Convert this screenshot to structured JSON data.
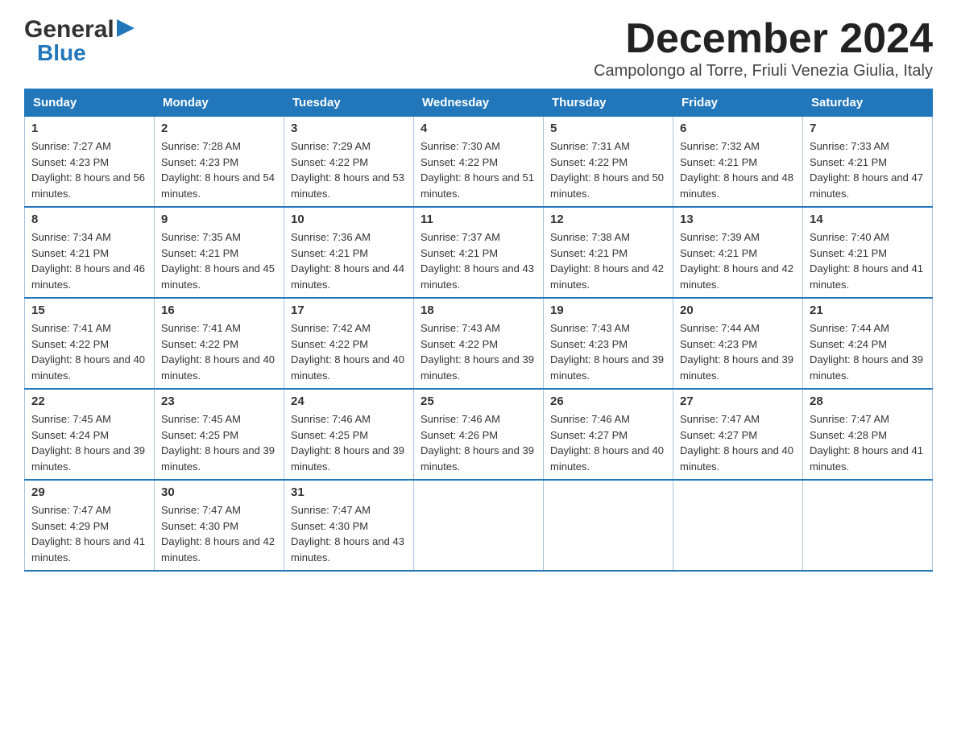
{
  "header": {
    "logo_general": "General",
    "logo_blue": "Blue",
    "title": "December 2024",
    "subtitle": "Campolongo al Torre, Friuli Venezia Giulia, Italy"
  },
  "calendar": {
    "days_of_week": [
      "Sunday",
      "Monday",
      "Tuesday",
      "Wednesday",
      "Thursday",
      "Friday",
      "Saturday"
    ],
    "weeks": [
      [
        {
          "day": "1",
          "sunrise": "7:27 AM",
          "sunset": "4:23 PM",
          "daylight": "8 hours and 56 minutes."
        },
        {
          "day": "2",
          "sunrise": "7:28 AM",
          "sunset": "4:23 PM",
          "daylight": "8 hours and 54 minutes."
        },
        {
          "day": "3",
          "sunrise": "7:29 AM",
          "sunset": "4:22 PM",
          "daylight": "8 hours and 53 minutes."
        },
        {
          "day": "4",
          "sunrise": "7:30 AM",
          "sunset": "4:22 PM",
          "daylight": "8 hours and 51 minutes."
        },
        {
          "day": "5",
          "sunrise": "7:31 AM",
          "sunset": "4:22 PM",
          "daylight": "8 hours and 50 minutes."
        },
        {
          "day": "6",
          "sunrise": "7:32 AM",
          "sunset": "4:21 PM",
          "daylight": "8 hours and 48 minutes."
        },
        {
          "day": "7",
          "sunrise": "7:33 AM",
          "sunset": "4:21 PM",
          "daylight": "8 hours and 47 minutes."
        }
      ],
      [
        {
          "day": "8",
          "sunrise": "7:34 AM",
          "sunset": "4:21 PM",
          "daylight": "8 hours and 46 minutes."
        },
        {
          "day": "9",
          "sunrise": "7:35 AM",
          "sunset": "4:21 PM",
          "daylight": "8 hours and 45 minutes."
        },
        {
          "day": "10",
          "sunrise": "7:36 AM",
          "sunset": "4:21 PM",
          "daylight": "8 hours and 44 minutes."
        },
        {
          "day": "11",
          "sunrise": "7:37 AM",
          "sunset": "4:21 PM",
          "daylight": "8 hours and 43 minutes."
        },
        {
          "day": "12",
          "sunrise": "7:38 AM",
          "sunset": "4:21 PM",
          "daylight": "8 hours and 42 minutes."
        },
        {
          "day": "13",
          "sunrise": "7:39 AM",
          "sunset": "4:21 PM",
          "daylight": "8 hours and 42 minutes."
        },
        {
          "day": "14",
          "sunrise": "7:40 AM",
          "sunset": "4:21 PM",
          "daylight": "8 hours and 41 minutes."
        }
      ],
      [
        {
          "day": "15",
          "sunrise": "7:41 AM",
          "sunset": "4:22 PM",
          "daylight": "8 hours and 40 minutes."
        },
        {
          "day": "16",
          "sunrise": "7:41 AM",
          "sunset": "4:22 PM",
          "daylight": "8 hours and 40 minutes."
        },
        {
          "day": "17",
          "sunrise": "7:42 AM",
          "sunset": "4:22 PM",
          "daylight": "8 hours and 40 minutes."
        },
        {
          "day": "18",
          "sunrise": "7:43 AM",
          "sunset": "4:22 PM",
          "daylight": "8 hours and 39 minutes."
        },
        {
          "day": "19",
          "sunrise": "7:43 AM",
          "sunset": "4:23 PM",
          "daylight": "8 hours and 39 minutes."
        },
        {
          "day": "20",
          "sunrise": "7:44 AM",
          "sunset": "4:23 PM",
          "daylight": "8 hours and 39 minutes."
        },
        {
          "day": "21",
          "sunrise": "7:44 AM",
          "sunset": "4:24 PM",
          "daylight": "8 hours and 39 minutes."
        }
      ],
      [
        {
          "day": "22",
          "sunrise": "7:45 AM",
          "sunset": "4:24 PM",
          "daylight": "8 hours and 39 minutes."
        },
        {
          "day": "23",
          "sunrise": "7:45 AM",
          "sunset": "4:25 PM",
          "daylight": "8 hours and 39 minutes."
        },
        {
          "day": "24",
          "sunrise": "7:46 AM",
          "sunset": "4:25 PM",
          "daylight": "8 hours and 39 minutes."
        },
        {
          "day": "25",
          "sunrise": "7:46 AM",
          "sunset": "4:26 PM",
          "daylight": "8 hours and 39 minutes."
        },
        {
          "day": "26",
          "sunrise": "7:46 AM",
          "sunset": "4:27 PM",
          "daylight": "8 hours and 40 minutes."
        },
        {
          "day": "27",
          "sunrise": "7:47 AM",
          "sunset": "4:27 PM",
          "daylight": "8 hours and 40 minutes."
        },
        {
          "day": "28",
          "sunrise": "7:47 AM",
          "sunset": "4:28 PM",
          "daylight": "8 hours and 41 minutes."
        }
      ],
      [
        {
          "day": "29",
          "sunrise": "7:47 AM",
          "sunset": "4:29 PM",
          "daylight": "8 hours and 41 minutes."
        },
        {
          "day": "30",
          "sunrise": "7:47 AM",
          "sunset": "4:30 PM",
          "daylight": "8 hours and 42 minutes."
        },
        {
          "day": "31",
          "sunrise": "7:47 AM",
          "sunset": "4:30 PM",
          "daylight": "8 hours and 43 minutes."
        },
        null,
        null,
        null,
        null
      ]
    ],
    "sunrise_label": "Sunrise:",
    "sunset_label": "Sunset:",
    "daylight_label": "Daylight:"
  }
}
